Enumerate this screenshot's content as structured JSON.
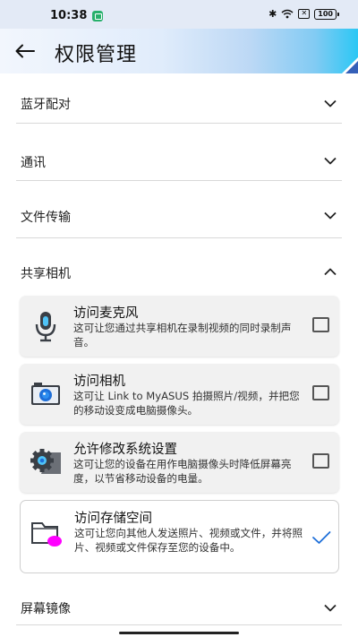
{
  "status_bar": {
    "time": "10:38",
    "bluetooth_icon": "bluetooth-icon",
    "wifi_icon": "wifi-icon",
    "sim_icon": "no-sim-icon",
    "battery_level": "100"
  },
  "header": {
    "title": "权限管理",
    "back_icon": "arrow-left-icon"
  },
  "sections": [
    {
      "label": "蓝牙配对",
      "expanded": false
    },
    {
      "label": "通讯",
      "expanded": false
    },
    {
      "label": "文件传输",
      "expanded": false
    },
    {
      "label": "共享相机",
      "expanded": true
    },
    {
      "label": "屏幕镜像",
      "expanded": false
    }
  ],
  "permissions": [
    {
      "title": "访问麦克风",
      "desc": "这可让您通过共享相机在录制视频的同时录制声音。",
      "icon": "microphone-icon",
      "checked": false
    },
    {
      "title": "访问相机",
      "desc": "这可让 Link to MyASUS 拍摄照片/视频，并把您的移动设变成电脑摄像头。",
      "icon": "camera-icon",
      "checked": false
    },
    {
      "title": "允许修改系统设置",
      "desc": "这可让您的设备在用作电脑摄像头时降低屏幕亮度，以节省移动设备的电量。",
      "icon": "settings-gear-icon",
      "checked": false
    },
    {
      "title": "访问存储空间",
      "desc": "这可让您向其他人发送照片、视频或文件，并将照片、视频或文件保存至您的设备中。",
      "icon": "folder-icon",
      "checked": true
    }
  ],
  "colors": {
    "accent": "#1e6fd9",
    "header_gradient_end": "#2bc7f4",
    "folder_dot": "#ff00ff"
  }
}
